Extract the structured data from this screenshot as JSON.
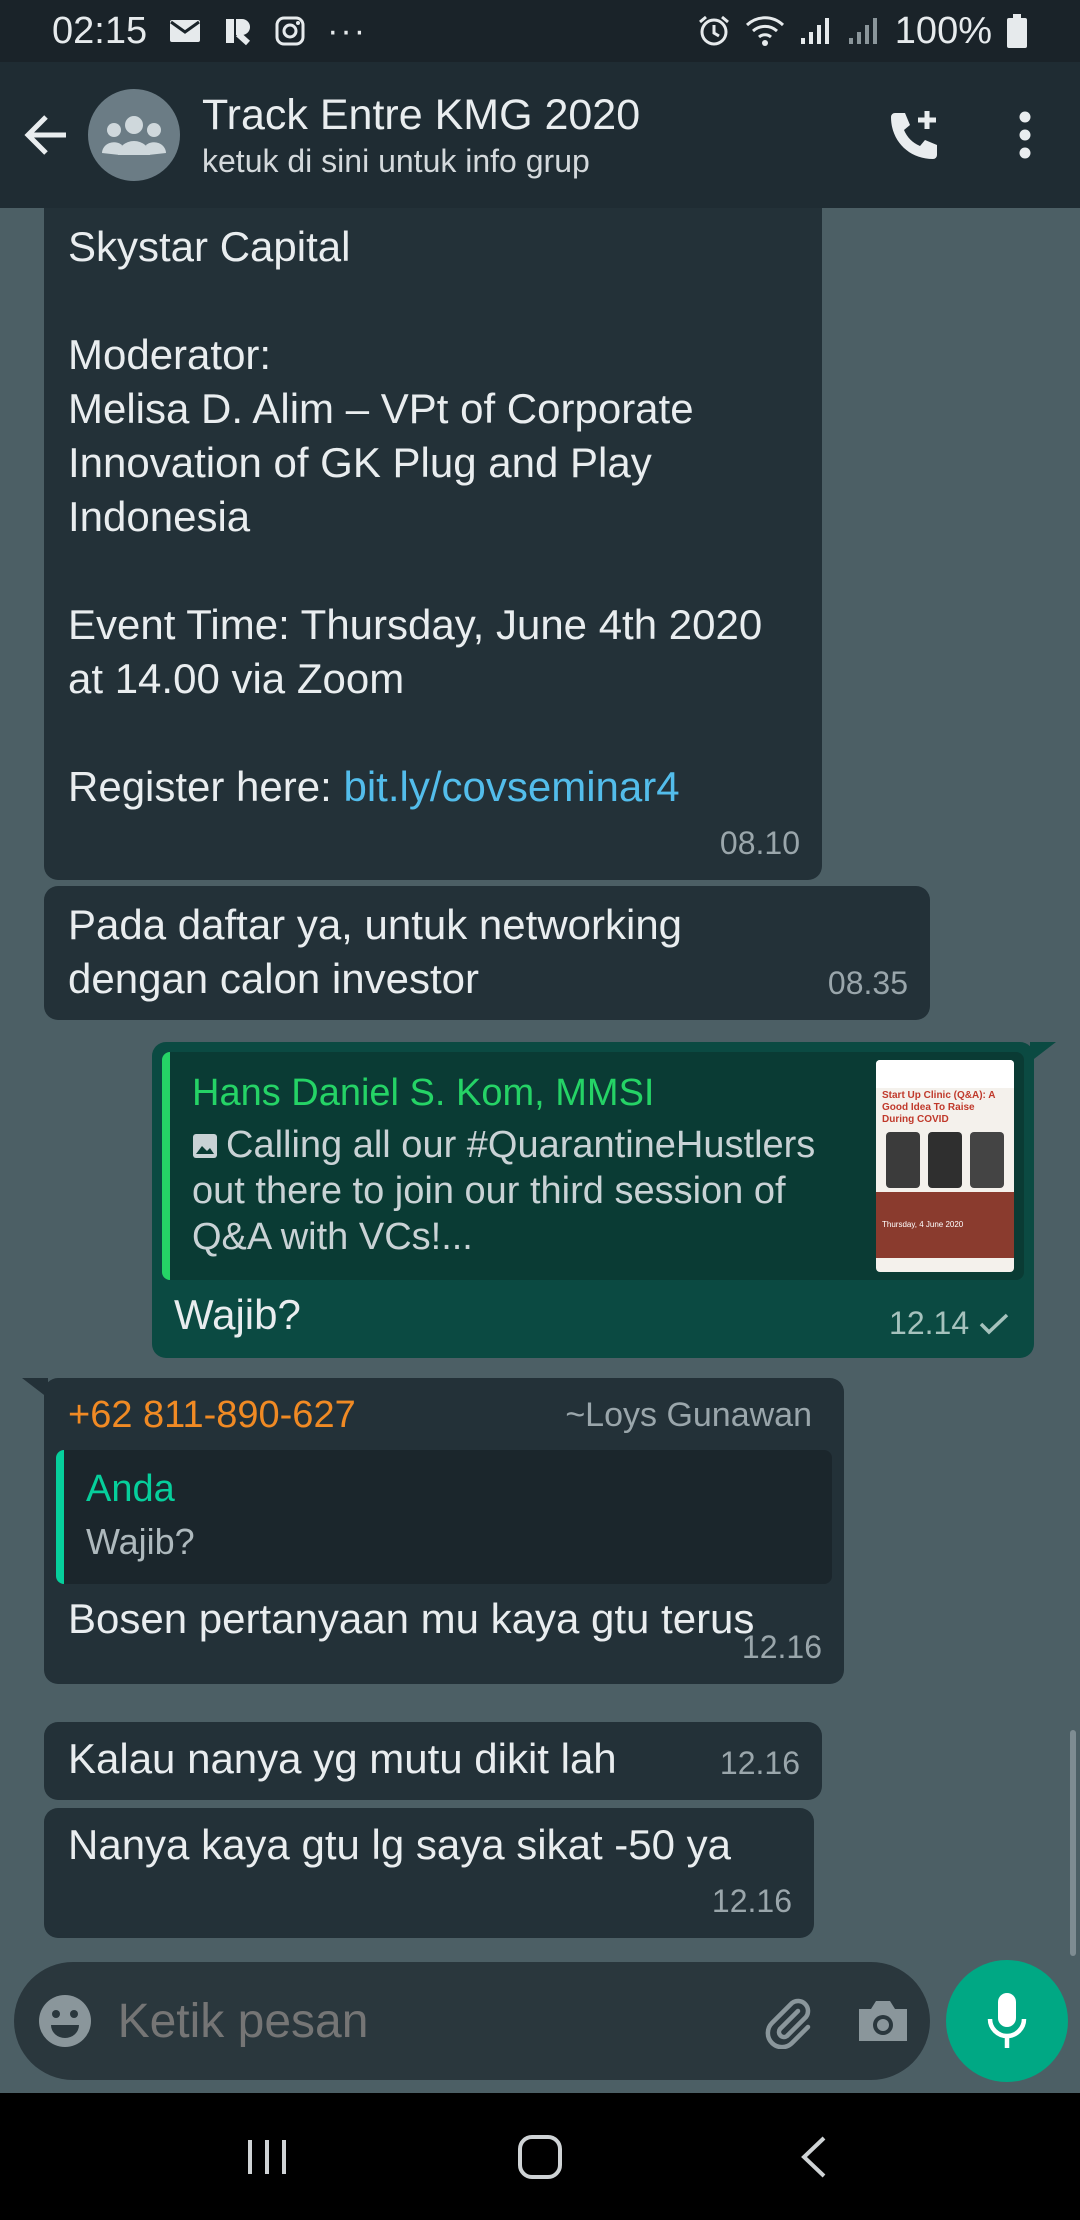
{
  "status_bar": {
    "time": "02:15",
    "dots": "···",
    "battery": "100%"
  },
  "header": {
    "title": "Track Entre KMG 2020",
    "subtitle": "ketuk di sini untuk info grup"
  },
  "messages": {
    "m1": {
      "text": "Skystar Capital\n\nModerator:\nMelisa D. Alim – VPt of Corporate Innovation of GK Plug and Play Indonesia\n\nEvent Time: Thursday, June 4th 2020 at 14.00 via Zoom\n\n",
      "register_label": "Register here: ",
      "link": "bit.ly/covseminar4",
      "time": "08.10"
    },
    "m2": {
      "text": "Pada daftar ya, untuk networking dengan calon investor",
      "time": "08.35"
    },
    "m3": {
      "quote_author": "Hans Daniel S. Kom, MMSI",
      "quote_text": "Calling all our #QuarantineHustlers out there to join our third session of Q&A with VCs!...",
      "thumb_title": "Start Up Clinic (Q&A): A Good Idea To Raise During COVID",
      "thumb_date": "Thursday, 4 June 2020",
      "text": "Wajib?",
      "time": "12.14"
    },
    "m4": {
      "sender_number": "+62 811-890-627",
      "sender_name": "~Loys Gunawan",
      "quote_author": "Anda",
      "quote_text": "Wajib?",
      "text": "Bosen pertanyaan mu kaya gtu terus",
      "time": "12.16"
    },
    "m5": {
      "text": "Kalau nanya yg mutu dikit lah",
      "time": "12.16"
    },
    "m6": {
      "text": "Nanya kaya gtu lg saya sikat -50 ya",
      "time": "12.16"
    }
  },
  "composer": {
    "placeholder": "Ketik pesan"
  },
  "icons": {
    "back": "arrow-left-icon",
    "group": "group-avatar-icon",
    "call": "add-call-icon",
    "menu": "more-vert-icon",
    "emoji": "emoji-icon",
    "attach": "paperclip-icon",
    "camera": "camera-icon",
    "mic": "mic-icon"
  },
  "colors": {
    "header": "#1f2c33",
    "chat_bg": "#4c5f65",
    "incoming_bubble": "#233138",
    "outgoing_bubble": "#0b4a42",
    "accent": "#00a884",
    "link": "#53bdeb"
  }
}
